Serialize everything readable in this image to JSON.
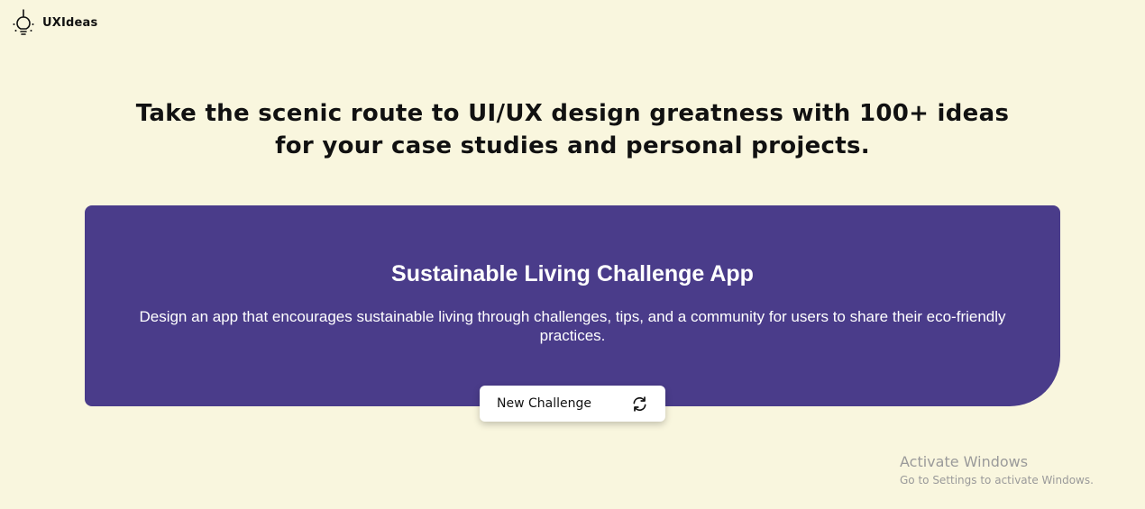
{
  "brand": {
    "name": "UXIdeas",
    "icon": "lightbulb-icon"
  },
  "hero": {
    "headline": "Take the scenic route to UI/UX design greatness with 100+ ideas for your case studies and personal projects."
  },
  "challenge": {
    "title": "Sustainable Living Challenge App",
    "description": "Design an app that encourages sustainable living through challenges, tips, and a community for users to share their eco-friendly practices."
  },
  "new_challenge_button": {
    "label": "New Challenge",
    "icon": "refresh-icon"
  },
  "watermark": {
    "title": "Activate Windows",
    "subtitle": "Go to Settings to activate Windows."
  },
  "colors": {
    "background": "#f9f6de",
    "card": "#4a3c8a",
    "card_text": "#ffffff",
    "button_bg": "#ffffff"
  }
}
